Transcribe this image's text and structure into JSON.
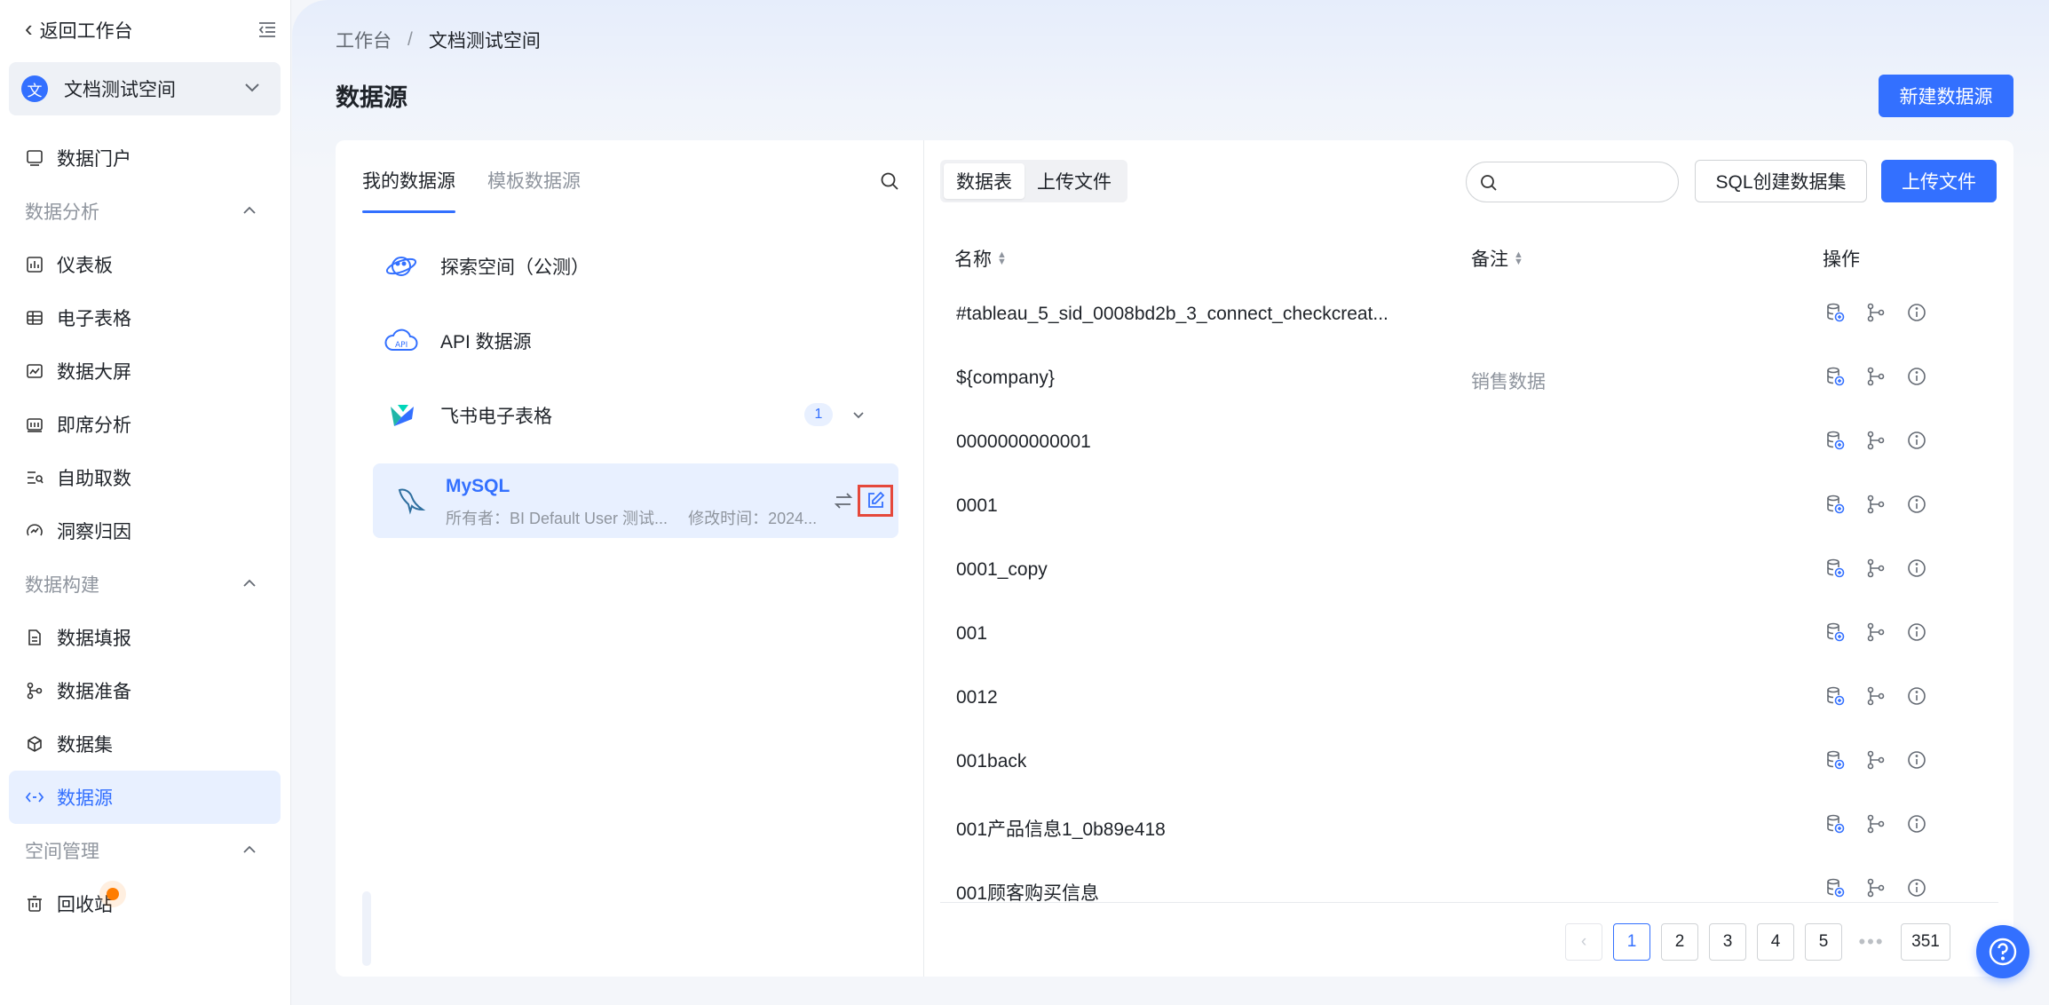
{
  "sidebar": {
    "back_label": "返回工作台",
    "space": {
      "logo_char": "文",
      "name": "文档测试空间"
    },
    "items": [
      {
        "type": "item",
        "label": "数据门户",
        "icon": "monitor-icon"
      },
      {
        "type": "group",
        "label": "数据分析"
      },
      {
        "type": "item",
        "label": "仪表板",
        "icon": "dashboard-icon"
      },
      {
        "type": "item",
        "label": "电子表格",
        "icon": "spreadsheet-icon"
      },
      {
        "type": "item",
        "label": "数据大屏",
        "icon": "big-screen-icon"
      },
      {
        "type": "item",
        "label": "即席分析",
        "icon": "adhoc-analysis-icon"
      },
      {
        "type": "item",
        "label": "自助取数",
        "icon": "self-service-icon"
      },
      {
        "type": "item",
        "label": "洞察归因",
        "icon": "insight-icon"
      },
      {
        "type": "group",
        "label": "数据构建"
      },
      {
        "type": "item",
        "label": "数据填报",
        "icon": "form-icon"
      },
      {
        "type": "item",
        "label": "数据准备",
        "icon": "data-prep-icon"
      },
      {
        "type": "item",
        "label": "数据集",
        "icon": "dataset-icon"
      },
      {
        "type": "item",
        "label": "数据源",
        "icon": "datasource-icon",
        "active": true
      },
      {
        "type": "group",
        "label": "空间管理"
      },
      {
        "type": "item",
        "label": "回收站",
        "icon": "trash-icon"
      }
    ]
  },
  "header": {
    "breadcrumb": [
      "工作台",
      "/",
      "文档测试空间"
    ],
    "title": "数据源",
    "new_button": "新建数据源"
  },
  "left_panel": {
    "tabs": [
      "我的数据源",
      "模板数据源"
    ],
    "sources": [
      {
        "name": "探索空间（公测）",
        "icon": "explore-planet-icon"
      },
      {
        "name": "API 数据源",
        "icon": "api-cloud-icon"
      },
      {
        "name": "飞书电子表格",
        "icon": "feishu-sheet-icon",
        "count": "1"
      }
    ],
    "selected": {
      "name": "MySQL",
      "owner": "所有者：BI Default User 测试...",
      "modified": "修改时间：2024..."
    }
  },
  "right_panel": {
    "segments": [
      "数据表",
      "上传文件"
    ],
    "search_placeholder": "",
    "sql_button": "SQL创建数据集",
    "upload_button": "上传文件",
    "columns": {
      "name": "名称",
      "remark": "备注",
      "ops": "操作"
    },
    "rows": [
      {
        "name": "#tableau_5_sid_0008bd2b_3_connect_checkcreat...",
        "remark": ""
      },
      {
        "name": "${company}",
        "remark": "销售数据"
      },
      {
        "name": "0000000000001",
        "remark": ""
      },
      {
        "name": "0001",
        "remark": ""
      },
      {
        "name": "0001_copy",
        "remark": ""
      },
      {
        "name": "001",
        "remark": ""
      },
      {
        "name": "0012",
        "remark": ""
      },
      {
        "name": "001back",
        "remark": ""
      },
      {
        "name": "001产品信息1_0b89e418",
        "remark": ""
      },
      {
        "name": "001顾客购买信息",
        "remark": ""
      }
    ],
    "pagination": {
      "pages": [
        "1",
        "2",
        "3",
        "4",
        "5"
      ],
      "ellipsis": "•••",
      "last": "351",
      "current": "1"
    }
  },
  "colors": {
    "primary": "#3370ff",
    "highlight_border": "#e5483b"
  }
}
